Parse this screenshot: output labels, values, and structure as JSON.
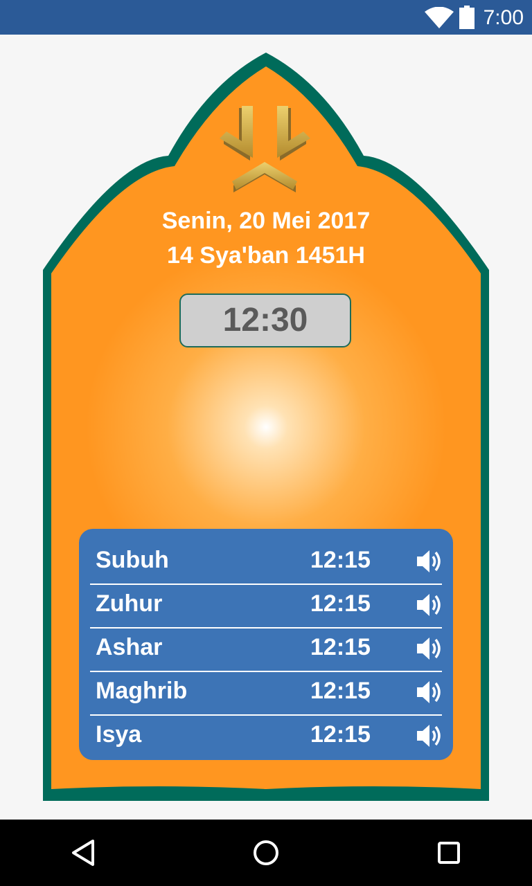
{
  "status_bar": {
    "time": "7:00",
    "icons": [
      "wifi-icon",
      "battery-icon"
    ]
  },
  "header": {
    "date_gregorian": "Senin, 20 Mei 2017",
    "date_hijri": "14 Sya'ban 1451H"
  },
  "clock": {
    "time": "12:30"
  },
  "prayers": [
    {
      "name": "Subuh",
      "time": "12:15",
      "icon": "speaker-icon"
    },
    {
      "name": "Zuhur",
      "time": "12:15",
      "icon": "speaker-icon"
    },
    {
      "name": "Ashar",
      "time": "12:15",
      "icon": "speaker-icon"
    },
    {
      "name": "Maghrib",
      "time": "12:15",
      "icon": "speaker-icon"
    },
    {
      "name": "Isya",
      "time": "12:15",
      "icon": "speaker-icon"
    }
  ],
  "nav_bar": {
    "buttons": [
      "back-icon",
      "home-icon",
      "recents-icon"
    ]
  },
  "colors": {
    "status_bar": "#2b5a97",
    "frame_border": "#006b5a",
    "frame_fill": "#ff9620",
    "prayer_panel": "#3d74b6",
    "clock_box": "#cfcfcf"
  }
}
